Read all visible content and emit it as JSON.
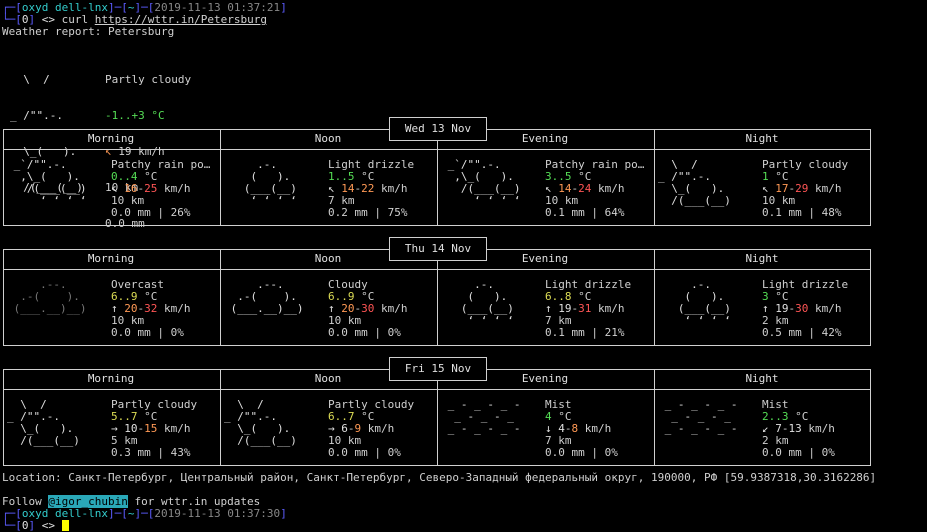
{
  "terminal": {
    "prompt1": {
      "user_host": "oxyd dell-lnx",
      "dir": "~",
      "time": "2019-11-13 01:37:21",
      "num": "0",
      "arrows": "<>",
      "cmd": "curl ",
      "url": "https://wttr.in/Petersburg"
    },
    "report_title": "Weather report: Petersburg",
    "current": {
      "icon": [
        "  \\  /",
        "_ /\"\".-.",
        "  \\_(   ).",
        "  /(___(__)"
      ],
      "cond": "Partly cloudy",
      "temp": "-1..+3 °C",
      "wind_arrow": "↖",
      "wind": "19 km/h",
      "vis": "10 km",
      "precip": "0.0 mm"
    },
    "days": [
      {
        "label": "Wed 13 Nov",
        "phases": [
          {
            "name": "Morning",
            "icon": [
              " _`/\"\".-.",
              "  ,\\_(   ).",
              "   /(___(__)",
              "     ‘ ‘ ‘ ‘"
            ],
            "icon_class": "w",
            "cond": "Patchy rain po…",
            "temp": "0..4",
            "temp_class": "g",
            "wind_arrow": "↖",
            "wind_lo": "16",
            "wind_hi": "25",
            "wind_lo_class": "o",
            "wind_hi_class": "r",
            "vis": "10 km",
            "precip": "0.0 mm | 26%"
          },
          {
            "name": "Noon",
            "icon": [
              "     .-.",
              "    (   ).",
              "   (___(__)",
              "    ‘ ‘ ‘ ‘"
            ],
            "icon_class": "w",
            "cond": "Light drizzle",
            "temp": "1..5",
            "temp_class": "g",
            "wind_arrow": "↖",
            "wind_lo": "14",
            "wind_hi": "22",
            "wind_lo_class": "o",
            "wind_hi_class": "o",
            "vis": "7 km",
            "precip": "0.2 mm | 75%"
          },
          {
            "name": "Evening",
            "icon": [
              " _`/\"\".-.",
              "  ,\\_(   ).",
              "   /(___(__)",
              "     ‘ ‘ ‘ ‘"
            ],
            "icon_class": "w",
            "cond": "Patchy rain po…",
            "temp": "3..5",
            "temp_class": "g",
            "wind_arrow": "↖",
            "wind_lo": "14",
            "wind_hi": "24",
            "wind_lo_class": "o",
            "wind_hi_class": "r",
            "vis": "10 km",
            "precip": "0.1 mm | 64%"
          },
          {
            "name": "Night",
            "icon": [
              "  \\  /",
              "_ /\"\".-.",
              "  \\_(   ).",
              "  /(___(__)"
            ],
            "icon_class": "w",
            "cond": "Partly cloudy",
            "temp": "1",
            "temp_class": "g",
            "wind_arrow": "↖",
            "wind_lo": "17",
            "wind_hi": "29",
            "wind_lo_class": "o",
            "wind_hi_class": "r",
            "vis": "10 km",
            "precip": "0.1 mm | 48%"
          }
        ]
      },
      {
        "label": "Thu 14 Nov",
        "phases": [
          {
            "name": "Morning",
            "icon": [
              "",
              "     .--.",
              "  .-(    ).",
              " (___.__)__)"
            ],
            "icon_class": "dim",
            "cond": "Overcast",
            "temp": "6..9",
            "temp_class": "y",
            "wind_arrow": "↑",
            "wind_lo": "20",
            "wind_hi": "32",
            "wind_lo_class": "o",
            "wind_hi_class": "r",
            "vis": "10 km",
            "precip": "0.0 mm | 0%"
          },
          {
            "name": "Noon",
            "icon": [
              "",
              "     .--.",
              "  .-(    ).",
              " (___.__)__)"
            ],
            "icon_class": "w",
            "cond": "Cloudy",
            "temp": "6..9",
            "temp_class": "y",
            "wind_arrow": "↑",
            "wind_lo": "20",
            "wind_hi": "30",
            "wind_lo_class": "o",
            "wind_hi_class": "r",
            "vis": "10 km",
            "precip": "0.0 mm | 0%"
          },
          {
            "name": "Evening",
            "icon": [
              "     .-.",
              "    (   ).",
              "   (___(__)",
              "    ‘ ‘ ‘ ‘"
            ],
            "icon_class": "w",
            "cond": "Light drizzle",
            "temp": "6..8",
            "temp_class": "y",
            "wind_arrow": "↑",
            "wind_lo": "19",
            "wind_hi": "31",
            "wind_lo_class": "w",
            "wind_hi_class": "r",
            "vis": "7 km",
            "precip": "0.1 mm | 21%"
          },
          {
            "name": "Night",
            "icon": [
              "     .-.",
              "    (   ).",
              "   (___(__)",
              "    ‘ ‘ ‘ ‘"
            ],
            "icon_class": "w",
            "cond": "Light drizzle",
            "temp": "3",
            "temp_class": "g",
            "wind_arrow": "↑",
            "wind_lo": "19",
            "wind_hi": "30",
            "wind_lo_class": "w",
            "wind_hi_class": "r",
            "vis": "2 km",
            "precip": "0.5 mm | 42%"
          }
        ]
      },
      {
        "label": "Fri 15 Nov",
        "phases": [
          {
            "name": "Morning",
            "icon": [
              "  \\  /",
              "_ /\"\".-.",
              "  \\_(   ).",
              "  /(___(__)"
            ],
            "icon_class": "w",
            "cond": "Partly cloudy",
            "temp": "5..7",
            "temp_class": "y",
            "wind_arrow": "→",
            "wind_lo": "10",
            "wind_hi": "15",
            "wind_lo_class": "w",
            "wind_hi_class": "o",
            "vis": "5 km",
            "precip": "0.3 mm | 43%"
          },
          {
            "name": "Noon",
            "icon": [
              "  \\  /",
              "_ /\"\".-.",
              "  \\_(   ).",
              "  /(___(__)"
            ],
            "icon_class": "w",
            "cond": "Partly cloudy",
            "temp": "6..7",
            "temp_class": "y",
            "wind_arrow": "→",
            "wind_lo": "6",
            "wind_hi": "9",
            "wind_lo_class": "w",
            "wind_hi_class": "o",
            "vis": "10 km",
            "precip": "0.0 mm | 0%"
          },
          {
            "name": "Evening",
            "icon": [
              "",
              " _ - _ - _ -",
              "  _ - _ - _",
              " _ - _ - _ -"
            ],
            "icon_class": "w",
            "cond": "Mist",
            "temp": "4",
            "temp_class": "g",
            "wind_arrow": "↓",
            "wind_lo": "4",
            "wind_hi": "8",
            "wind_lo_class": "w",
            "wind_hi_class": "o",
            "vis": "7 km",
            "precip": "0.0 mm | 0%"
          },
          {
            "name": "Night",
            "icon": [
              "",
              " _ - _ - _ -",
              "  _ - _ - _",
              " _ - _ - _ -"
            ],
            "icon_class": "w",
            "cond": "Mist",
            "temp": "2..3",
            "temp_class": "g",
            "wind_arrow": "↙",
            "wind_lo": "7",
            "wind_hi": "13",
            "wind_lo_class": "w",
            "wind_hi_class": "w",
            "vis": "2 km",
            "precip": "0.0 mm | 0%"
          }
        ]
      }
    ],
    "location": "Location: Санкт-Петербург, Центральный район, Санкт-Петербург, Северо-Западный федеральный округ, 190000, РФ [59.9387318,30.3162286]",
    "follow_pre": "Follow ",
    "follow_handle": "@igor_chubin",
    "follow_post": " for wttr.in updates",
    "prompt2": {
      "user_host": "oxyd dell-lnx",
      "dir": "~",
      "time": "2019-11-13 01:37:30",
      "num": "0",
      "arrows": "<>"
    },
    "unit": "°C",
    "wind_unit": "km/h"
  }
}
